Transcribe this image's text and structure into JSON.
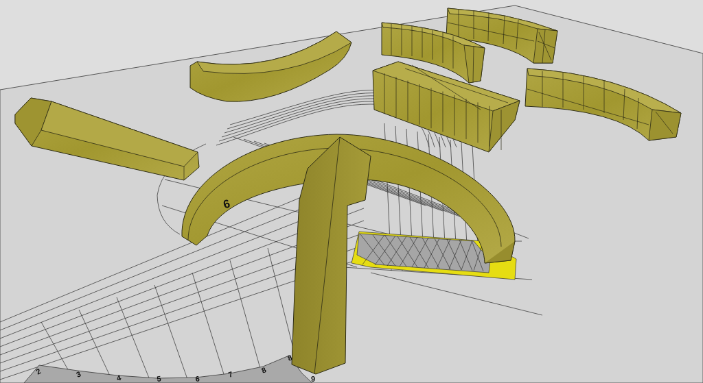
{
  "viewport": {
    "grid_labels": [
      "2",
      "3",
      "4",
      "5",
      "6",
      "7",
      "8",
      "8",
      "9"
    ],
    "section_label": "6"
  }
}
